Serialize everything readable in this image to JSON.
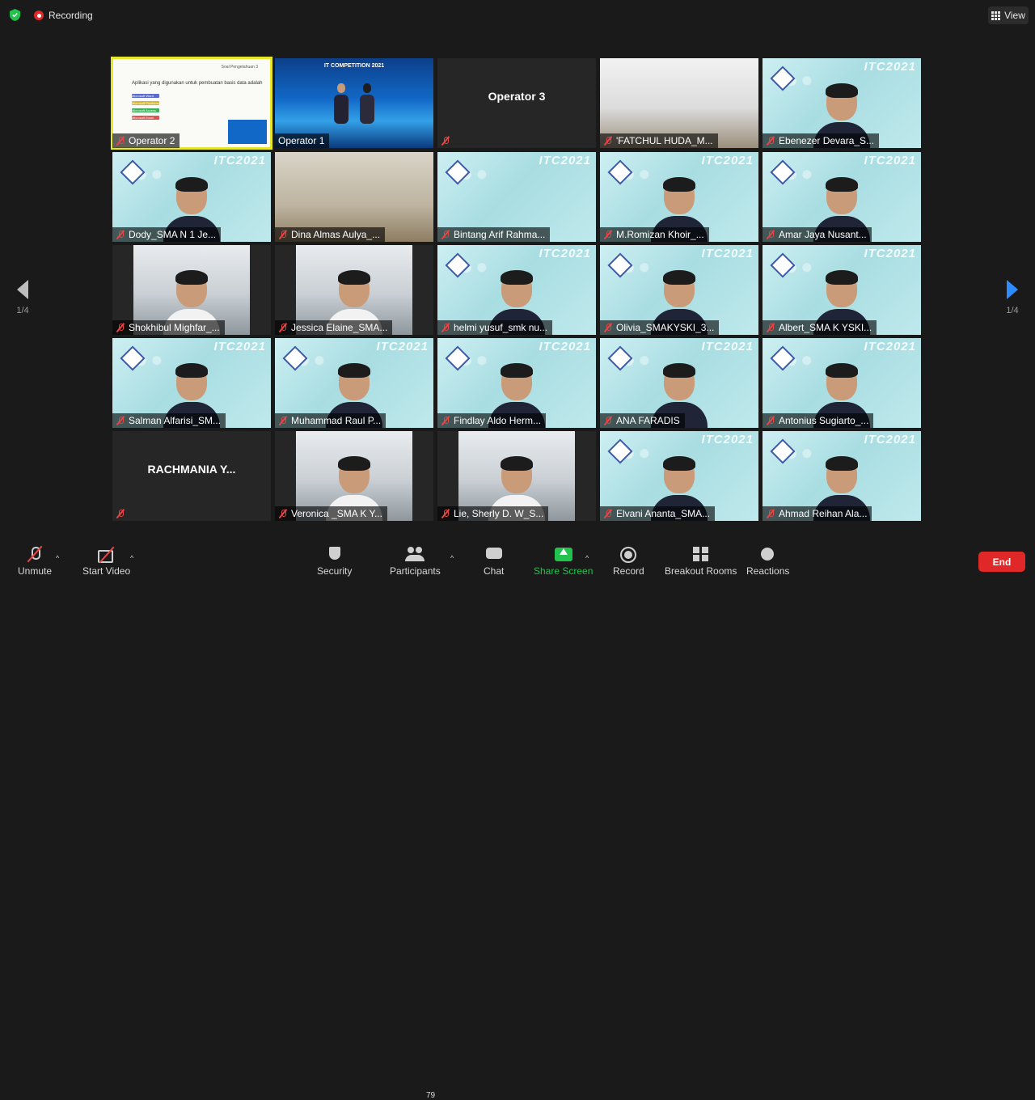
{
  "top": {
    "recording_label": "Recording",
    "view_label": "View"
  },
  "pager": {
    "left_label": "1/4",
    "right_label": "1/4"
  },
  "slide": {
    "header": "Soal Pengetahuan 3",
    "question": "Aplikasi yang digunakan untuk pembuatan basis data adalah",
    "options": [
      "Microsoft Word",
      "Microsoft Publisher",
      "Microsoft Access",
      "Microsoft Excel"
    ],
    "option_colors": [
      "#5b6cc8",
      "#d4b632",
      "#3fae5a",
      "#d9534f"
    ]
  },
  "stage": {
    "banner": "IT COMPETITION 2021"
  },
  "itc_logo": "ITC2021",
  "participants": [
    {
      "name": "Operator 2",
      "type": "slide",
      "muted": true,
      "active": true
    },
    {
      "name": "Operator 1",
      "type": "stage",
      "muted": false
    },
    {
      "name": "Operator 3",
      "type": "name",
      "muted": true
    },
    {
      "name": "'FATCHUL HUDA_M...",
      "type": "ceiling",
      "muted": true
    },
    {
      "name": "Ebenezer Devara_S...",
      "type": "itc",
      "muted": true
    },
    {
      "name": "Dody_SMA N 1 Je...",
      "type": "itc",
      "muted": true
    },
    {
      "name": "Dina Almas Aulya_...",
      "type": "room",
      "muted": true
    },
    {
      "name": "Bintang Arif Rahma...",
      "type": "itc-empty",
      "muted": true
    },
    {
      "name": "M.Romizan Khoir_...",
      "type": "itc",
      "muted": true
    },
    {
      "name": "Amar Jaya Nusant...",
      "type": "itc",
      "muted": true
    },
    {
      "name": "Shokhibul Mighfar_...",
      "type": "webcam",
      "muted": true
    },
    {
      "name": "Jessica Elaine_SMA...",
      "type": "webcam",
      "muted": true
    },
    {
      "name": "helmi yusuf_smk nu...",
      "type": "itc",
      "muted": true
    },
    {
      "name": "Olivia_SMAKYSKI_3...",
      "type": "itc",
      "muted": true
    },
    {
      "name": "Albert_SMA K YSKI...",
      "type": "itc",
      "muted": true
    },
    {
      "name": "Salman Alfarisi_SM...",
      "type": "itc",
      "muted": true
    },
    {
      "name": "Muhammad Raul P...",
      "type": "itc",
      "muted": true
    },
    {
      "name": "Findlay Aldo Herm...",
      "type": "itc",
      "muted": true
    },
    {
      "name": "ANA FARADIS",
      "type": "itc",
      "muted": true
    },
    {
      "name": "Antonius Sugiarto_...",
      "type": "itc",
      "muted": true
    },
    {
      "name": "RACHMANIA Y...",
      "type": "name",
      "muted": true
    },
    {
      "name": "Veronica _SMA K Y...",
      "type": "webcam",
      "muted": true
    },
    {
      "name": "Lie, Sherly D. W_S...",
      "type": "webcam",
      "muted": true
    },
    {
      "name": "Elvani Ananta_SMA...",
      "type": "itc",
      "muted": true
    },
    {
      "name": "Ahmad Reihan Ala...",
      "type": "itc",
      "muted": true
    }
  ],
  "toolbar": {
    "unmute": "Unmute",
    "start_video": "Start Video",
    "security": "Security",
    "participants": "Participants",
    "participants_count": "79",
    "chat": "Chat",
    "share_screen": "Share Screen",
    "record": "Record",
    "breakout_rooms": "Breakout Rooms",
    "reactions": "Reactions",
    "end": "End"
  },
  "colors": {
    "background": "#1a1a1a",
    "active_speaker": "#e7e72a",
    "share_green": "#23c24f",
    "end_red": "#e02828",
    "muted_red": "#e84545",
    "accent_blue": "#2d8cff"
  },
  "icons": {
    "security": "shield-icon",
    "participants": "people-icon",
    "chat": "chat-icon",
    "share": "share-screen-icon",
    "record": "record-icon",
    "breakout": "breakout-rooms-icon",
    "reactions": "reactions-icon"
  }
}
